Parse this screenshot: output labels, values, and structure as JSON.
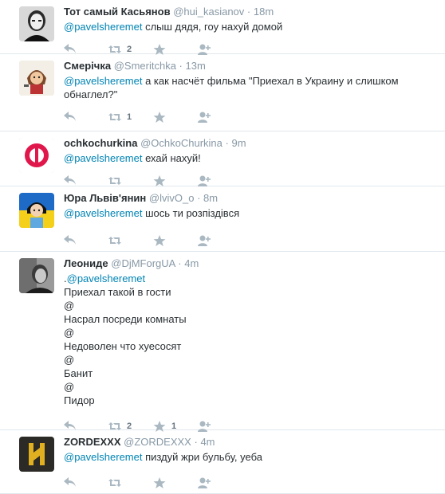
{
  "tweets": [
    {
      "name": "Тот самый Касьянов",
      "handle": "@hui_kasianov",
      "time": "18m",
      "mention": "@pavelsheremet",
      "text": " слыш дядя, гоу нахуй домой",
      "retweets": "2",
      "favorites": "",
      "avatar_icon": "avatar-bald-man-icon"
    },
    {
      "name": "Смерічка",
      "handle": "@Smeritchka",
      "time": "13m",
      "mention": "@pavelsheremet",
      "text": " а как насчёт фильма \"Приехал в Украину и слишком обнаглел?\"",
      "retweets": "1",
      "favorites": "",
      "avatar_icon": "avatar-cartoon-girl-icon"
    },
    {
      "name": "ochkochurkina",
      "handle": "@OchkoChurkina",
      "time": "9m",
      "mention": "@pavelsheremet",
      "text": " ехай нахуй!",
      "retweets": "",
      "favorites": "",
      "avatar_icon": "avatar-red-logo-icon"
    },
    {
      "name": "Юра Львів'янин",
      "handle": "@lvivO_o",
      "time": "8m",
      "mention": "@pavelsheremet",
      "text": " шось ти розпіздівся",
      "retweets": "",
      "favorites": "",
      "avatar_icon": "avatar-flag-cartoon-icon"
    },
    {
      "name": "Леониде",
      "handle": "@DjMForgUA",
      "time": "4m",
      "mention_prefix": ".",
      "mention": "@pavelsheremet",
      "text": "",
      "lines": [
        "Приехал такой в гости",
        "@",
        "Насрал посреди комнаты",
        "@",
        "Недоволен что хуесосят",
        "@",
        "Банит",
        "@",
        "Пидор"
      ],
      "retweets": "2",
      "favorites": "1",
      "avatar_icon": "avatar-photo-man-icon"
    },
    {
      "name": "ZORDEXXX",
      "handle": "@ZORDEXXX",
      "time": "4m",
      "mention": "@pavelsheremet",
      "text": " пиздуй жри бульбу, уеба",
      "retweets": "",
      "favorites": "",
      "avatar_icon": "avatar-wolfsangel-icon"
    }
  ],
  "colors": {
    "name": "#292f33",
    "meta": "#8899a6",
    "mention": "#0084b4",
    "icon": "#aab8c2",
    "divider": "#e1e8ed"
  }
}
